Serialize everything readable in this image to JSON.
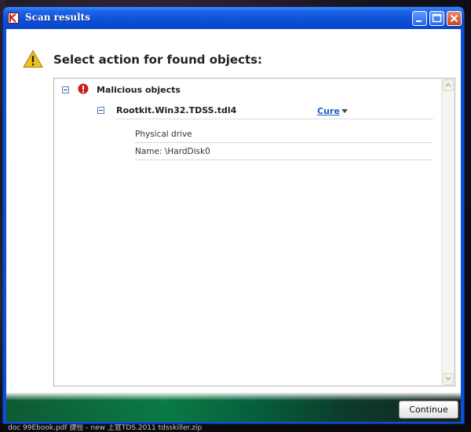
{
  "window": {
    "title": "Scan results",
    "icon": "kaspersky-k-icon",
    "controls": [
      "minimize-icon",
      "maximize-icon",
      "close-icon"
    ]
  },
  "header": {
    "icon": "warning-icon",
    "title": "Select action for found objects:"
  },
  "list": {
    "group": {
      "label": "Malicious objects",
      "icon": "error-icon",
      "expanded": true,
      "items": [
        {
          "name": "Rootkit.Win32.TDSS.tdl4",
          "action": "Cure",
          "expanded": true,
          "details": [
            "Physical drive",
            "Name: \\HardDisk0"
          ]
        }
      ]
    }
  },
  "footer": {
    "continue_label": "Continue"
  },
  "taskbar": {
    "text": "doc     99Ebook.pdf    捷徑 - new     上官TDS.2011    tdsskiller.zip"
  },
  "colors": {
    "title_bar": "#0b4fd8",
    "link": "#1b5fbf",
    "error_red": "#c81e1e",
    "warning_yellow": "#f2c21a",
    "footer_green": "#0a7a45"
  }
}
